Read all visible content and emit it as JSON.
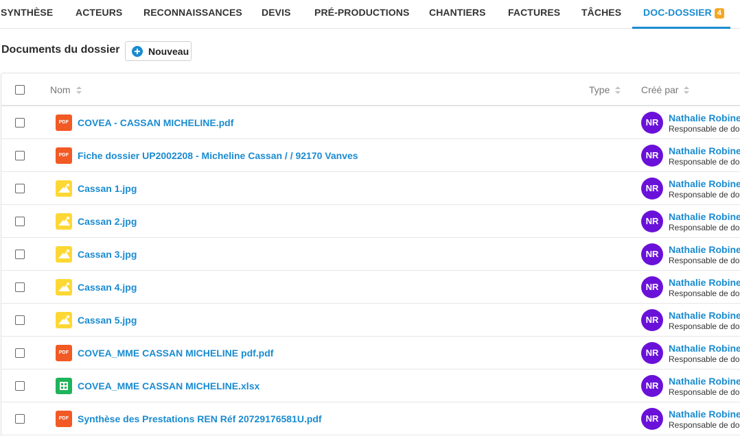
{
  "tabs": [
    {
      "label": "SYNTHÈSE"
    },
    {
      "label": "ACTEURS"
    },
    {
      "label": "RECONNAISSANCES"
    },
    {
      "label": "DEVIS"
    },
    {
      "label": "PRÉ-PRODUCTIONS"
    },
    {
      "label": "CHANTIERS"
    },
    {
      "label": "FACTURES"
    },
    {
      "label": "TÂCHES"
    },
    {
      "label": "DOC-DOSSIER",
      "badge": "4",
      "active": true
    }
  ],
  "section": {
    "title": "Documents du dossier",
    "new_button": "Nouveau"
  },
  "table": {
    "columns": {
      "name": "Nom",
      "type": "Type",
      "created_by": "Créé par"
    },
    "rows": [
      {
        "icon": "pdf-file-icon",
        "icon_label": "PDF",
        "name": "COVEA - CASSAN MICHELINE.pdf",
        "user_initials": "NR",
        "user_name": "Nathalie Robine",
        "user_role": "Responsable de dos"
      },
      {
        "icon": "pdf-file-icon",
        "icon_label": "PDF",
        "name": "Fiche dossier UP2002208 - Micheline Cassan /  / 92170 Vanves",
        "user_initials": "NR",
        "user_name": "Nathalie Robine",
        "user_role": "Responsable de dos"
      },
      {
        "icon": "image-file-icon",
        "name": "Cassan 1.jpg",
        "user_initials": "NR",
        "user_name": "Nathalie Robine",
        "user_role": "Responsable de dos"
      },
      {
        "icon": "image-file-icon",
        "name": "Cassan 2.jpg",
        "user_initials": "NR",
        "user_name": "Nathalie Robine",
        "user_role": "Responsable de dos"
      },
      {
        "icon": "image-file-icon",
        "name": "Cassan 3.jpg",
        "user_initials": "NR",
        "user_name": "Nathalie Robine",
        "user_role": "Responsable de dos"
      },
      {
        "icon": "image-file-icon",
        "name": "Cassan 4.jpg",
        "user_initials": "NR",
        "user_name": "Nathalie Robine",
        "user_role": "Responsable de dos"
      },
      {
        "icon": "image-file-icon",
        "name": "Cassan 5.jpg",
        "user_initials": "NR",
        "user_name": "Nathalie Robine",
        "user_role": "Responsable de dos"
      },
      {
        "icon": "pdf-file-icon",
        "icon_label": "PDF",
        "name": "COVEA_MME CASSAN MICHELINE pdf.pdf",
        "user_initials": "NR",
        "user_name": "Nathalie Robine",
        "user_role": "Responsable de dos"
      },
      {
        "icon": "spreadsheet-file-icon",
        "name": "COVEA_MME CASSAN MICHELINE.xlsx",
        "user_initials": "NR",
        "user_name": "Nathalie Robine",
        "user_role": "Responsable de dos"
      },
      {
        "icon": "pdf-file-icon",
        "icon_label": "PDF",
        "name": "Synthèse des Prestations REN Réf 20729176581U.pdf",
        "user_initials": "NR",
        "user_name": "Nathalie Robine",
        "user_role": "Responsable de dos"
      }
    ]
  },
  "colors": {
    "accent": "#1a8bd0",
    "badge": "#f5a623",
    "avatar": "#6a11d9",
    "pdf": "#f15a24",
    "image": "#fdd835",
    "spreadsheet": "#1fb35a"
  }
}
